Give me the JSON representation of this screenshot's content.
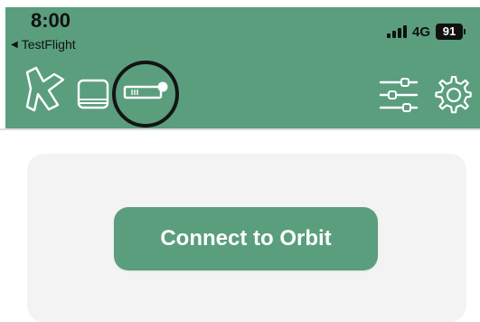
{
  "status_bar": {
    "time": "8:00",
    "back_app": "TestFlight",
    "network": "4G",
    "battery": "91"
  },
  "toolbar": {
    "icons": [
      "plane-icon",
      "book-icon",
      "device-icon",
      "sliders-icon",
      "gear-icon"
    ]
  },
  "main": {
    "connect_label": "Connect to Orbit"
  },
  "colors": {
    "accent": "#5a9e7d",
    "card": "#f3f3f3"
  }
}
